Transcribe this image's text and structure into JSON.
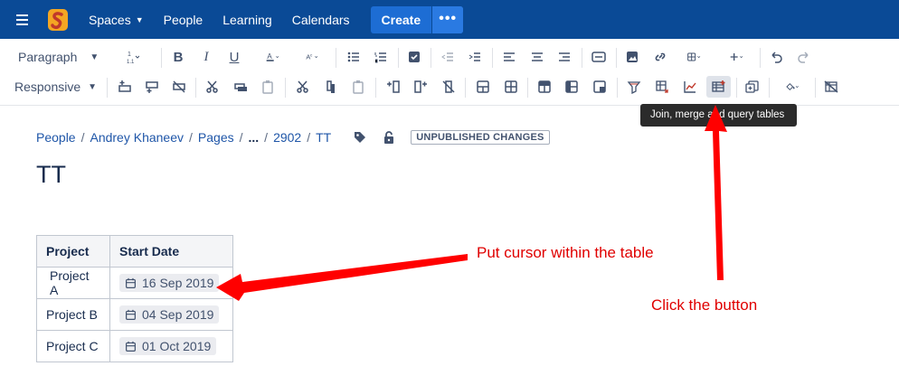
{
  "nav": {
    "spaces": "Spaces",
    "people": "People",
    "learning": "Learning",
    "calendars": "Calendars",
    "create": "Create",
    "more": "•••"
  },
  "toolbar": {
    "paragraph": "Paragraph",
    "responsive": "Responsive",
    "tooltip": "Join, merge and query tables",
    "icons_row1": [
      "text-size-icon",
      "bold-icon",
      "italic-icon",
      "underline-icon",
      "text-color-icon",
      "clear-format-icon",
      "bullet-list-icon",
      "numbered-list-icon",
      "task-icon",
      "outdent-icon",
      "indent-icon",
      "align-left-icon",
      "align-center-icon",
      "align-right-icon",
      "layout-icon",
      "image-icon",
      "link-icon",
      "table-icon",
      "insert-icon",
      "undo-icon",
      "redo-icon"
    ],
    "icons_row2": [
      "row-above-icon",
      "row-below-icon",
      "delete-row-icon",
      "cut-row-icon",
      "copy-row-icon",
      "paste-row-icon",
      "cut-col-icon",
      "copy-col-icon",
      "paste-col-icon",
      "col-before-icon",
      "col-after-icon",
      "delete-col-icon",
      "merge-cells-icon",
      "split-cells-icon",
      "header-row-icon",
      "header-col-icon",
      "numbered-col-icon",
      "filter-table-icon",
      "pivot-table-icon",
      "chart-icon",
      "table-toolbox-icon",
      "table-copy-icon",
      "cell-color-icon",
      "delete-table-icon"
    ]
  },
  "breadcrumb": {
    "items": [
      "People",
      "Andrey Khaneev",
      "Pages",
      "...",
      "2902",
      "TT"
    ],
    "separator": "/",
    "badge": "UNPUBLISHED CHANGES"
  },
  "page": {
    "title": "TT"
  },
  "table": {
    "headers": [
      "Project",
      "Start Date"
    ],
    "rows": [
      [
        "Project A",
        "16 Sep 2019"
      ],
      [
        "Project B",
        "04 Sep 2019"
      ],
      [
        "Project C",
        "01 Oct 2019"
      ]
    ]
  },
  "annotations": {
    "cursor": "Put cursor within the table",
    "click": "Click the button"
  },
  "colors": {
    "nav_bg": "#0a4a96",
    "create_bg": "#1d6dd4",
    "annotation": "#e00000"
  }
}
